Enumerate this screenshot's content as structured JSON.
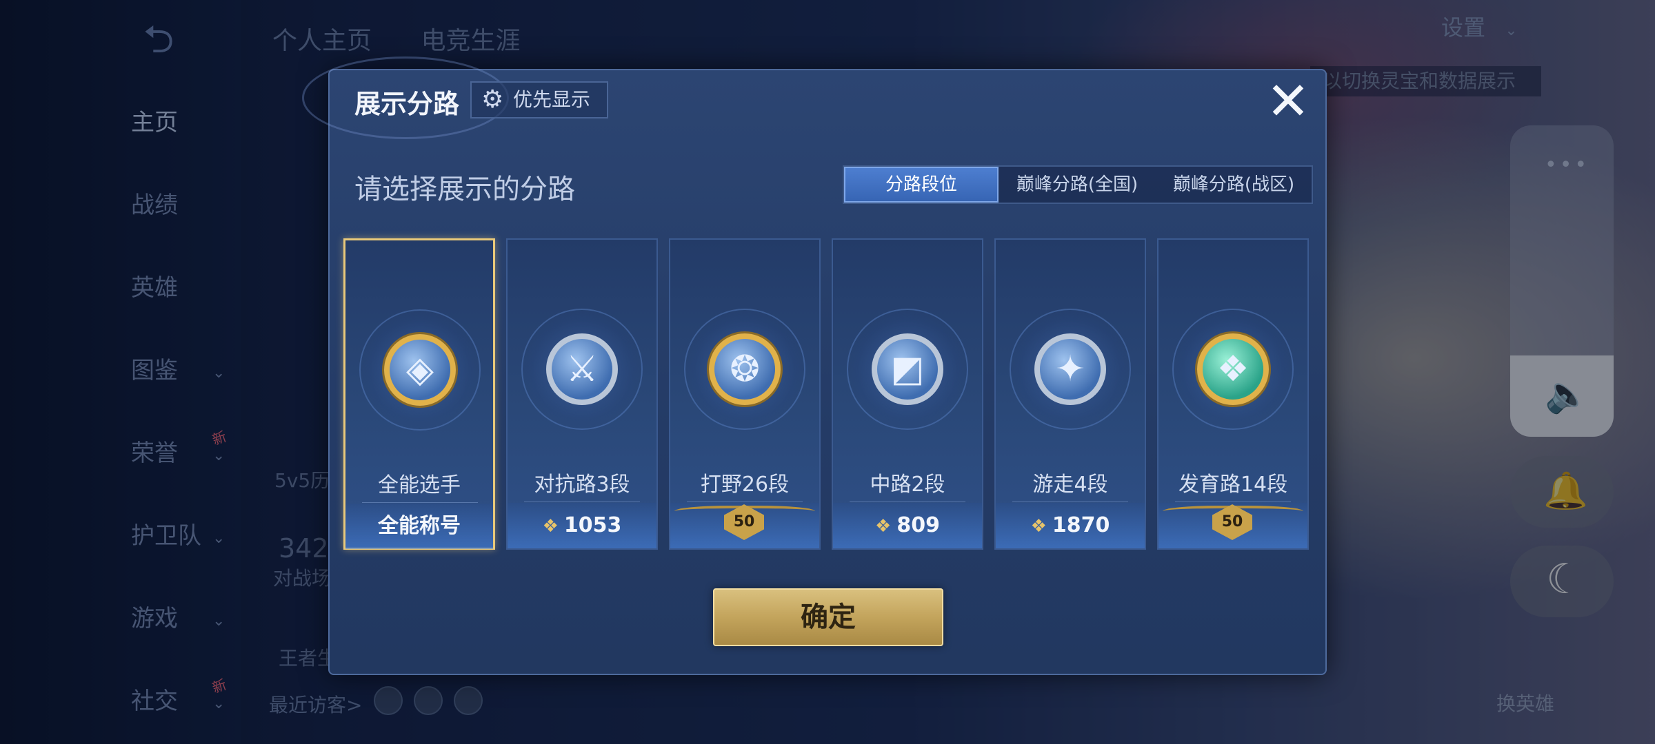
{
  "background": {
    "nav": [
      {
        "label": "主页",
        "active": true,
        "chevron": false,
        "new": false
      },
      {
        "label": "战绩",
        "active": false,
        "chevron": false,
        "new": false
      },
      {
        "label": "英雄",
        "active": false,
        "chevron": false,
        "new": false
      },
      {
        "label": "图鉴",
        "active": false,
        "chevron": true,
        "new": false
      },
      {
        "label": "荣誉",
        "active": false,
        "chevron": true,
        "new": true
      },
      {
        "label": "护卫队",
        "active": false,
        "chevron": true,
        "new": false
      },
      {
        "label": "游戏",
        "active": false,
        "chevron": true,
        "new": false
      },
      {
        "label": "社交",
        "active": false,
        "chevron": true,
        "new": true
      }
    ],
    "new_badge": "新",
    "top_tabs": [
      "个人主页",
      "电竞生涯"
    ],
    "settings_label": "设置",
    "hint_text": "以切换灵宝和数据展示",
    "recent_visitors": "最近访客>",
    "fragment_5v5": "5v5历",
    "fragment_342": "342",
    "fragment_battle": "对战场",
    "fragment_king": "王者生",
    "swap_hero": "换英雄"
  },
  "modal": {
    "title": "展示分路",
    "priority_button": "优先显示",
    "subtitle": "请选择展示的分路",
    "tabs": [
      {
        "label": "分路段位",
        "active": true
      },
      {
        "label": "巅峰分路(全国)",
        "active": false
      },
      {
        "label": "巅峰分路(战区)",
        "active": false
      }
    ],
    "cards": [
      {
        "name": "全能选手",
        "footer": "全能称号",
        "footer_type": "text",
        "emblem": "all-round-emblem-icon",
        "selected": true
      },
      {
        "name": "对抗路3段",
        "footer": "1053",
        "footer_type": "points",
        "emblem": "clash-lane-emblem-icon",
        "selected": false
      },
      {
        "name": "打野26段",
        "footer": "50",
        "footer_type": "badge",
        "emblem": "jungle-emblem-icon",
        "selected": false
      },
      {
        "name": "中路2段",
        "footer": "809",
        "footer_type": "points",
        "emblem": "mid-lane-emblem-icon",
        "selected": false
      },
      {
        "name": "游走4段",
        "footer": "1870",
        "footer_type": "points",
        "emblem": "roam-emblem-icon",
        "selected": false
      },
      {
        "name": "发育路14段",
        "footer": "50",
        "footer_type": "badge",
        "emblem": "farm-lane-emblem-icon",
        "selected": false
      }
    ],
    "confirm_button": "确定"
  },
  "colors": {
    "accent_blue": "#3765b4",
    "gold": "#e9c97a",
    "modal_bg": "#2c4572"
  }
}
